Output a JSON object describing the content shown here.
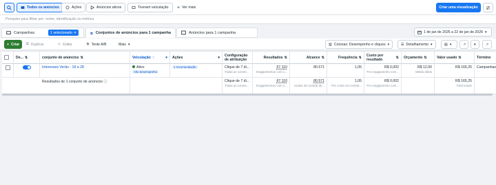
{
  "top": {
    "filters": [
      "Todos os anúncios",
      "Ações",
      "Anúncios ativos",
      "Tiveram veiculação"
    ],
    "more_label": "Ver mais",
    "create_view": "Criar uma visualização"
  },
  "search": {
    "placeholder": "Pesquise para filtrar por: nome, identificação ou métrica"
  },
  "tabs": {
    "campaigns": "Campanhas",
    "selected_badge": "1 selecionado",
    "adsets": "Conjuntos de anúncios para 1 campanha",
    "ads": "Anúncios para 1 campanha",
    "date_range": "1 de jan de 2026 a 22 de jan de 2026"
  },
  "toolbar": {
    "create": "Criar",
    "duplicate": "Duplicar",
    "edit": "Editar",
    "ab_test": "Teste A/B",
    "more": "Mais",
    "columns": "Colunas: Desempenho e cliques",
    "breakdown": "Detalhamento"
  },
  "table": {
    "headers": {
      "toggle": "De...",
      "name": "conjunto de anúncios",
      "delivery": "Veiculação",
      "actions": "Ações",
      "attribution": "Configuração de atribuição",
      "results": "Resultados",
      "reach": "Alcance",
      "frequency": "Frequência",
      "cost": "Custo por resultado",
      "budget": "Orçamento",
      "spent": "Valor usado",
      "end": "Término"
    },
    "row": {
      "name": "Interesses Verão - 18 a 28",
      "delivery_status": "Ativo",
      "delivery_badge": "Alto desempenho",
      "actions_badge": "1 recomendação",
      "attribution": "Clique de 7 di...",
      "attribution_sub": "Todas as conver...",
      "results": "67.110",
      "results_sub": "Engajamentos com o...",
      "reach": "80.571",
      "frequency": "1,05",
      "cost": "R$ 0,002",
      "cost_sub": "Por engajamento com...",
      "budget": "R$ 12,00",
      "budget_sub": "Média diária",
      "spent": "R$ 165,25",
      "end": "Campanhas"
    },
    "summary": {
      "label": "Resultados de 1 conjunto de anúncios",
      "attribution": "Clique de 7 di...",
      "attribution_sub": "Todas as conver...",
      "results": "67.110",
      "results_sub": "Engajamentos com o...",
      "reach": "80.571",
      "reach_sub": "contas da Central de...",
      "frequency": "1,05",
      "frequency_sub": "Por conta na Central...",
      "cost": "R$ 0,002",
      "cost_sub": "Por engajamento com...",
      "spent": "R$ 165,25",
      "spent_sub": "Total usado"
    }
  }
}
